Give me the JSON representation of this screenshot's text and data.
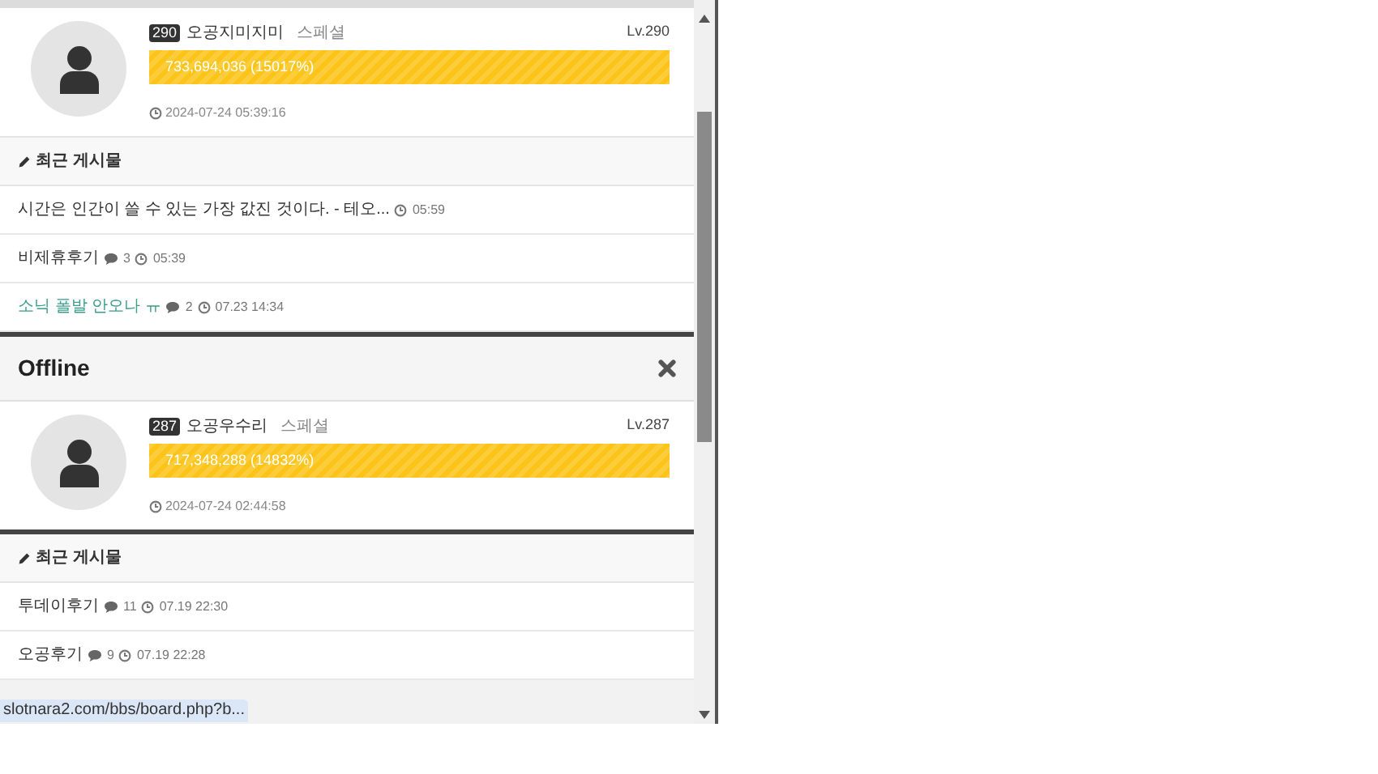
{
  "sections": [
    {
      "profile": {
        "badge": "290",
        "name": "오공지미지미",
        "rank": "스페셜",
        "level_text": "Lv.290",
        "exp": "733,694,036 (15017%)",
        "level": 1,
        "last_seen": "2024-07-24 05:39:16"
      },
      "recent": {
        "title": "최근 게시물",
        "posts": [
          {
            "title": "시간은 인간이 쓸 수 있는 가장 값진 것이다. - 테오...",
            "time": "05:59",
            "color": "#333333"
          },
          {
            "title": "비제휴후기",
            "comments": "3",
            "time": "05:39",
            "color": "#333333"
          },
          {
            "title": "소닉 폴발 안오나 ㅠ",
            "comments": "2",
            "time": "07.23 14:34",
            "color": "#3a9e8a"
          }
        ]
      }
    },
    {
      "header": "Offline",
      "profile": {
        "badge": "287",
        "name": "오공우수리",
        "rank": "스페셜",
        "level_text": "Lv.287",
        "exp": "717,348,288 (14832%)",
        "level": 1,
        "last_seen": "2024-07-24 02:44:58"
      },
      "recent": {
        "title": "최근 게시물",
        "posts": [
          {
            "title": "투데이후기",
            "comments": "11",
            "time": "07.19 22:30",
            "color": "#333333"
          },
          {
            "title": "오공후기",
            "comments": "9",
            "time": "07.19 22:28",
            "color": "#333333"
          }
        ]
      }
    }
  ],
  "status_url": "slotnara2.com/bbs/board.php?b..."
}
